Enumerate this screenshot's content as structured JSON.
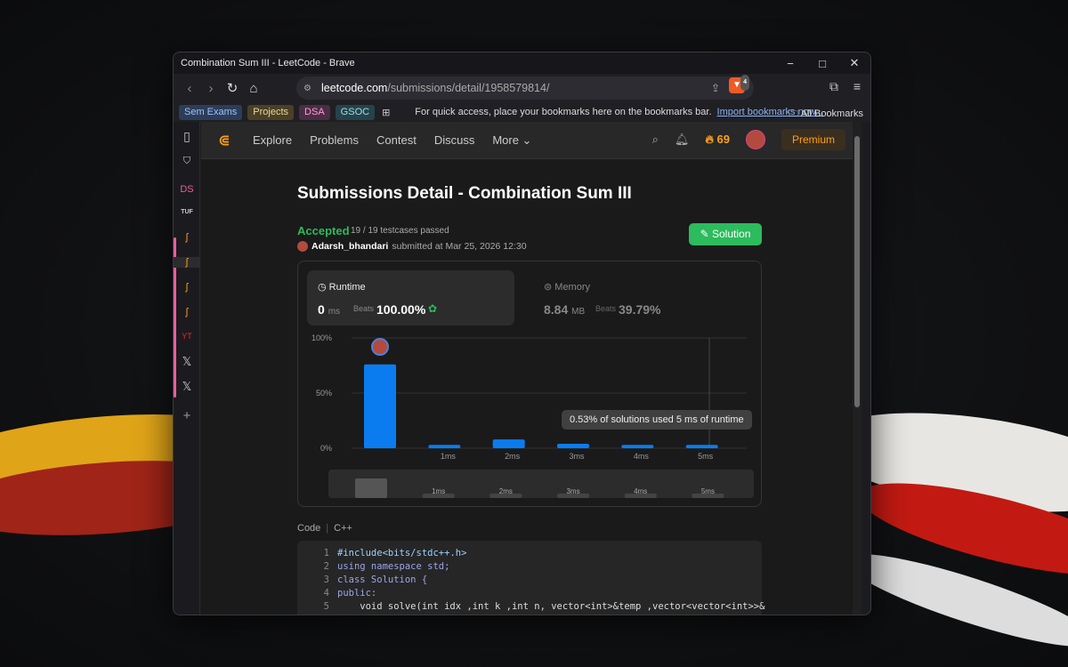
{
  "window": {
    "title": "Combination Sum III - LeetCode - Brave",
    "controls": [
      "−",
      "□",
      "✕"
    ]
  },
  "address_bar": {
    "domain": "leetcode.com",
    "path": "/submissions/detail/1958579814/",
    "shield_count": "4"
  },
  "bookmarks": {
    "chips": [
      {
        "label": "Sem Exams",
        "bg": "#2d3d57",
        "fg": "#9cc2ff"
      },
      {
        "label": "Projects",
        "bg": "#4a4026",
        "fg": "#e8d89a"
      },
      {
        "label": "DSA",
        "bg": "#4a2e45",
        "fg": "#ff9ad5"
      },
      {
        "label": "GSOC",
        "bg": "#26424a",
        "fg": "#9adfe8"
      }
    ],
    "message": "For quick access, place your bookmarks here on the bookmarks bar.",
    "import_link": "Import bookmarks now...",
    "all_bookmarks": "All Bookmarks"
  },
  "sidebar": {
    "items": [
      "DS",
      "TUF",
      "YT",
      "𝕏",
      "𝕏",
      "+"
    ]
  },
  "lc_nav": {
    "items": [
      "Explore",
      "Problems",
      "Contest",
      "Discuss",
      "More ⌄"
    ],
    "streak": "69",
    "premium": "Premium"
  },
  "page": {
    "title": "Submissions Detail - Combination Sum III",
    "status": "Accepted",
    "testcases": "19 / 19 testcases passed",
    "user": "Adarsh_bhandari",
    "submitted": "submitted at Mar 25, 2026 12:30",
    "solution_button": "Solution"
  },
  "runtime": {
    "label": "Runtime",
    "value": "0",
    "unit": "ms",
    "beats_label": "Beats",
    "beats": "100.00%"
  },
  "memory": {
    "label": "Memory",
    "value": "8.84",
    "unit": "MB",
    "beats_label": "Beats",
    "beats": "39.79%"
  },
  "chart_data": {
    "type": "bar",
    "categories": [
      "0ms",
      "1ms",
      "2ms",
      "3ms",
      "4ms",
      "5ms"
    ],
    "tick_labels": [
      "",
      "1ms",
      "2ms",
      "3ms",
      "4ms",
      "5ms"
    ],
    "values": [
      76,
      3,
      8,
      4,
      3,
      3
    ],
    "y_ticks": [
      "100%",
      "50%",
      "0%"
    ],
    "ylim": [
      0,
      100
    ],
    "tooltip": "0.53% of solutions used 5 ms of runtime",
    "bar_color": "#0a7cf0"
  },
  "code": {
    "header": "Code",
    "language": "C++",
    "lines": [
      {
        "n": "1",
        "t": "#include<bits/stdc++.h>"
      },
      {
        "n": "2",
        "t": "using namespace std;"
      },
      {
        "n": "3",
        "t": "class Solution {"
      },
      {
        "n": "4",
        "t": "public:"
      },
      {
        "n": "5",
        "t": "    void solve(int idx ,int k ,int n, vector<int>&temp ,vector<vector<int>>&"
      }
    ]
  }
}
